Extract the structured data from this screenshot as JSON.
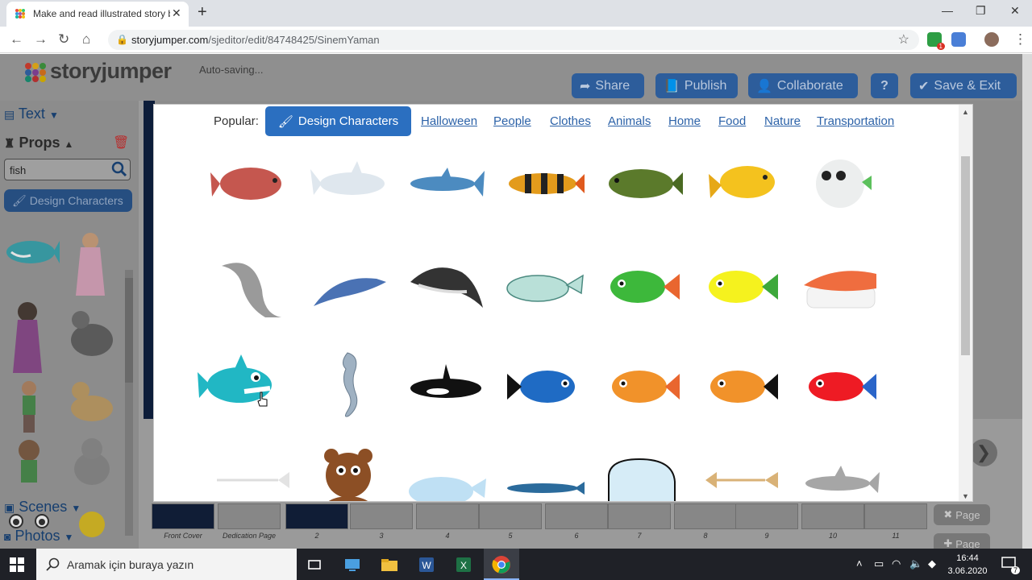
{
  "browser": {
    "tab_title": "Make and read illustrated story b",
    "url_host": "storyjumper.com",
    "url_path": "/sjeditor/edit/84748425/SinemYaman",
    "ext_badge": "1"
  },
  "app": {
    "logo_text": "storyjumper",
    "autosave": "Auto-saving...",
    "buttons": {
      "share": "Share",
      "publish": "Publish",
      "collaborate": "Collaborate",
      "help": "?",
      "save_exit": "Save & Exit"
    }
  },
  "left_panel": {
    "text_section": "Text",
    "props_section": "Props",
    "search_value": "fish",
    "design_characters": "Design Characters",
    "scenes_section": "Scenes",
    "photos_section": "Photos"
  },
  "modal": {
    "popular_label": "Popular:",
    "design_button": "Design Characters",
    "categories": [
      "Halloween",
      "People",
      "Clothes",
      "Animals",
      "Home",
      "Food",
      "Nature",
      "Transportation"
    ],
    "items": [
      "red-fish",
      "white-shark",
      "blue-shark",
      "striped-loach-fish",
      "green-spotted-fish",
      "yellow-fish",
      "pufferfish",
      "gray-dolphin",
      "blue-dolphin",
      "dark-dolphin",
      "teal-whale",
      "green-cartoon-fish",
      "yellow-cartoon-fish",
      "salmon-sushi",
      "cartoon-shark",
      "seahorse",
      "orca",
      "blue-cartoon-fish",
      "orange-cartoon-fish",
      "orange-black-fish",
      "red-blue-fish",
      "fish-skeleton",
      "bear-with-fish",
      "light-blue-whale",
      "blue-whale",
      "cartoon-whale",
      "fish-bone",
      "gray-shark"
    ]
  },
  "pages": {
    "labels": [
      "Front Cover",
      "Dedication Page",
      "2",
      "3",
      "4",
      "5",
      "6",
      "7",
      "8",
      "9",
      "10",
      "11"
    ],
    "delete_page": "Page",
    "add_page": "Page"
  },
  "taskbar": {
    "search_placeholder": "Aramak için buraya yazın",
    "time": "16:44",
    "date": "3.06.2020",
    "notifications": "7"
  },
  "colors": {
    "accent": "#2b6fc0",
    "header_btn": "#2d5d9b"
  }
}
